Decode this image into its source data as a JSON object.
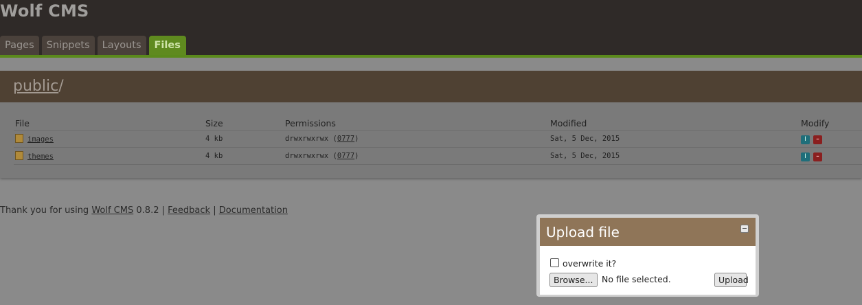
{
  "header": {
    "title": "Wolf CMS",
    "tabs": [
      {
        "label": "Pages",
        "active": false
      },
      {
        "label": "Snippets",
        "active": false
      },
      {
        "label": "Layouts",
        "active": false
      },
      {
        "label": "Files",
        "active": true
      }
    ]
  },
  "colors": {
    "header_bg": "#2f2a28",
    "accent_green": "#5b8a1c",
    "panel_head": "#4f4133",
    "dialog_head": "#8f7558"
  },
  "breadcrumb": {
    "folder": "public",
    "separator": "/"
  },
  "file_table": {
    "columns": [
      "File",
      "Size",
      "Permissions",
      "Modified",
      "Modify"
    ],
    "rows": [
      {
        "name": "images",
        "size": "4 kb",
        "permissions": "drwxrwxrwx",
        "octal": "0777",
        "modified": "Sat, 5 Dec, 2015",
        "icon": "folder-icon"
      },
      {
        "name": "themes",
        "size": "4 kb",
        "permissions": "drwxrwxrwx",
        "octal": "0777",
        "modified": "Sat, 5 Dec, 2015",
        "icon": "folder-icon"
      }
    ]
  },
  "footer": {
    "text_prefix": "Thank you for using",
    "cms_link": "Wolf CMS",
    "version": "0.8.2",
    "sep": "|",
    "feedback_link": "Feedback",
    "documentation_link": "Documentation"
  },
  "upload_dialog": {
    "title": "Upload file",
    "overwrite_label": "overwrite it?",
    "browse_label": "Browse...",
    "no_file_text": "No file selected.",
    "upload_label": "Upload"
  }
}
